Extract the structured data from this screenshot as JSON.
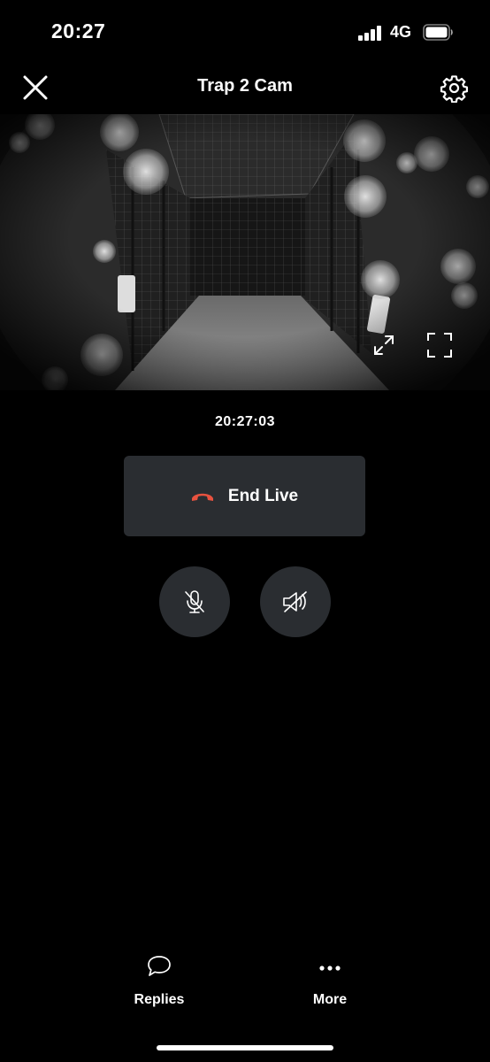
{
  "status_bar": {
    "time": "20:27",
    "network": "4G"
  },
  "header": {
    "title": "Trap 2 Cam"
  },
  "video": {
    "timestamp": "20:27:03"
  },
  "controls": {
    "end_live_label": "End Live",
    "end_color": "#e8523f"
  },
  "bottom_bar": {
    "replies_label": "Replies",
    "more_label": "More"
  },
  "icons": {
    "close": "close-icon",
    "settings": "gear-icon",
    "expand": "expand-icon",
    "fullscreen": "fullscreen-icon",
    "phone": "phone-hangup-icon",
    "mic": "mic-muted-icon",
    "speaker": "speaker-muted-icon",
    "replies": "speech-bubble-icon",
    "more": "ellipsis-icon"
  }
}
